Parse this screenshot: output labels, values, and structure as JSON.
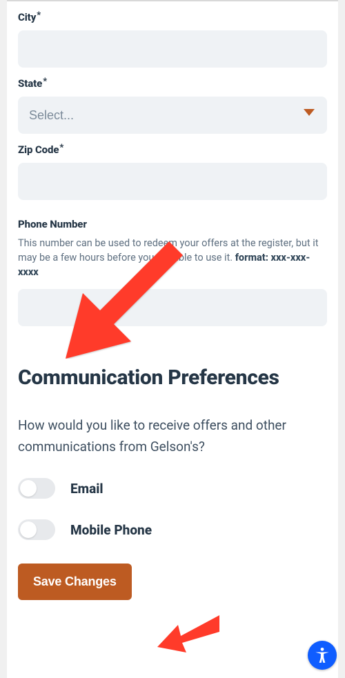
{
  "form": {
    "city": {
      "label": "City",
      "required": true,
      "value": "",
      "placeholder": ""
    },
    "state": {
      "label": "State",
      "required": true,
      "placeholder": "Select...",
      "value": ""
    },
    "zip": {
      "label": "Zip Code",
      "required": true,
      "value": "",
      "placeholder": ""
    },
    "phone": {
      "label": "Phone Number",
      "helper_prefix": "This number can be used to redeem your offers at the register, but it may be a few hours before you are able to use it. ",
      "helper_bold": "format: xxx-xxx-xxxx",
      "value": "",
      "placeholder": ""
    }
  },
  "prefs": {
    "heading": "Communication Preferences",
    "question": "How would you like to receive offers and other communications from Gelson's?",
    "options": {
      "email": {
        "label": "Email",
        "on": false
      },
      "mobile": {
        "label": "Mobile Phone",
        "on": false
      }
    }
  },
  "actions": {
    "save": "Save Changes"
  },
  "annotations": {
    "arrow1": true,
    "arrow2": true
  },
  "a11y_button": "accessibility"
}
